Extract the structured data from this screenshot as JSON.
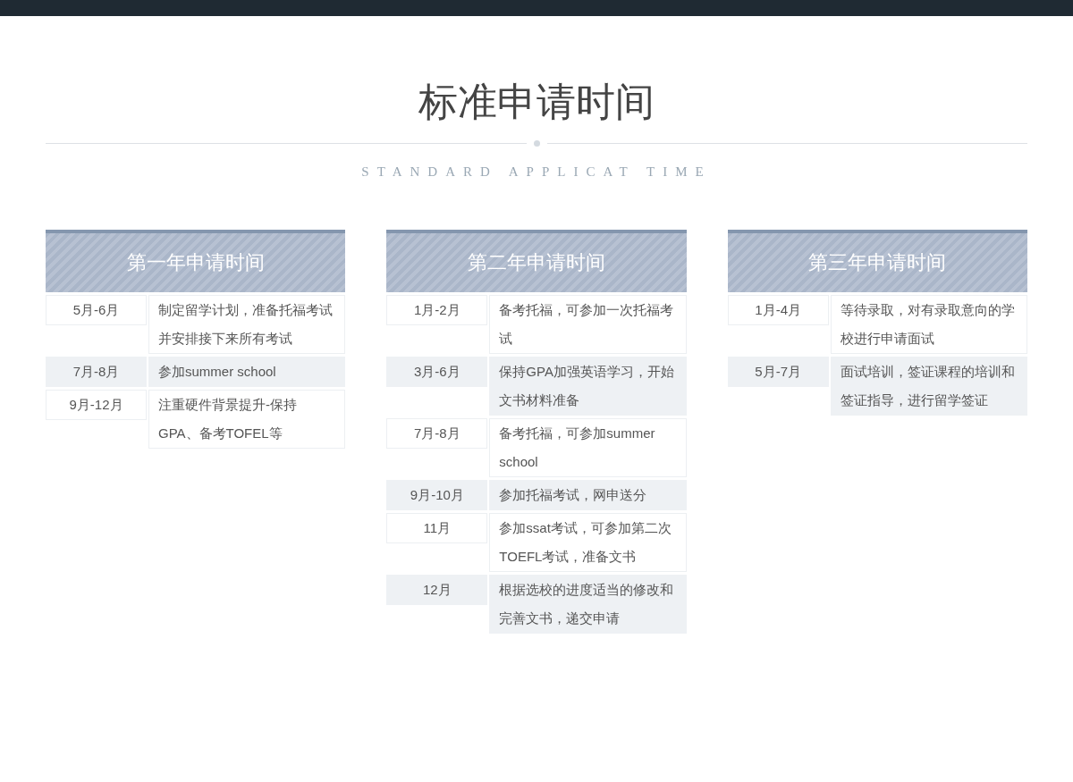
{
  "title": "标准申请时间",
  "subtitle": "STANDARD APPLICAT TIME",
  "columns": [
    {
      "heading": "第一年申请时间",
      "rows": [
        {
          "period": "5月-6月",
          "task": "制定留学计划，准备托福考试并安排接下来所有考试"
        },
        {
          "period": "7月-8月",
          "task": "参加summer school"
        },
        {
          "period": "9月-12月",
          "task": "注重硬件背景提升-保持GPA、备考TOFEL等"
        }
      ]
    },
    {
      "heading": "第二年申请时间",
      "rows": [
        {
          "period": "1月-2月",
          "task": "备考托福，可参加一次托福考试"
        },
        {
          "period": "3月-6月",
          "task": "保持GPA加强英语学习，开始文书材料准备"
        },
        {
          "period": "7月-8月",
          "task": "备考托福，可参加summer school"
        },
        {
          "period": "9月-10月",
          "task": "参加托福考试，网申送分"
        },
        {
          "period": "11月",
          "task": "参加ssat考试，可参加第二次TOEFL考试，准备文书"
        },
        {
          "period": "12月",
          "task": "根据选校的进度适当的修改和完善文书，递交申请"
        }
      ]
    },
    {
      "heading": "第三年申请时间",
      "rows": [
        {
          "period": "1月-4月",
          "task": "等待录取，对有录取意向的学校进行申请面试"
        },
        {
          "period": "5月-7月",
          "task": "面试培训，签证课程的培训和签证指导，进行留学签证"
        }
      ]
    }
  ]
}
